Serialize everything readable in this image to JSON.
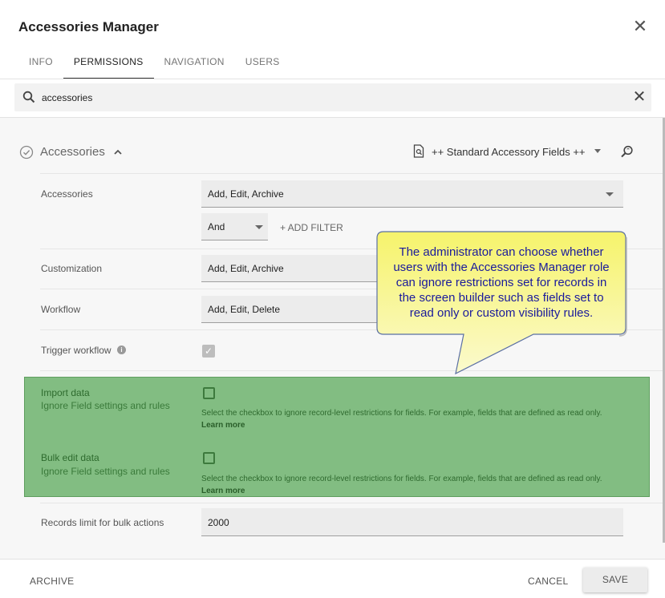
{
  "dialog": {
    "title": "Accessories Manager",
    "close_icon": "close-icon"
  },
  "tabs": [
    {
      "label": "INFO",
      "active": false
    },
    {
      "label": "PERMISSIONS",
      "active": true
    },
    {
      "label": "NAVIGATION",
      "active": false
    },
    {
      "label": "USERS",
      "active": false
    }
  ],
  "search": {
    "value": "accessories",
    "icon": "search-icon",
    "clear_icon": "clear-icon"
  },
  "section": {
    "title": "Accessories",
    "field_set": "++ Standard Accessory Fields ++",
    "icons": [
      "check-circle-icon",
      "chevron-up-icon",
      "document-search-icon",
      "zoom-icon"
    ]
  },
  "rows": {
    "accessories": {
      "label": "Accessories",
      "value": "Add, Edit, Archive"
    },
    "filter": {
      "operator": "And",
      "add_filter": "+ ADD FILTER"
    },
    "customization": {
      "label": "Customization",
      "value": "Add, Edit, Archive"
    },
    "workflow": {
      "label": "Workflow",
      "value": "Add, Edit, Delete"
    },
    "trigger_workflow": {
      "label": "Trigger workflow",
      "checked": true
    },
    "import_data": {
      "label": "Import data",
      "sublabel": "Ignore Field settings and rules",
      "checked": false,
      "help": "Select the checkbox to ignore record-level restrictions for fields. For example, fields that are defined as read only.",
      "learn_more": "Learn more"
    },
    "bulk_edit": {
      "label": "Bulk edit data",
      "sublabel": "Ignore Field settings and rules",
      "checked": false,
      "help": "Select the checkbox to ignore record-level restrictions for fields. For example, fields that are defined as read only.",
      "learn_more": "Learn more"
    },
    "records_limit": {
      "label": "Records limit for bulk actions",
      "value": "2000"
    }
  },
  "callout": {
    "line1": "The administrator can choose whether",
    "line2": "users with the Accessories Manager role",
    "line3": "can ignore restrictions set for records in",
    "line4": "the screen builder such as fields set to",
    "line5": "read only or custom visibility rules."
  },
  "footer": {
    "archive": "ARCHIVE",
    "cancel": "CANCEL",
    "save": "SAVE"
  },
  "colors": {
    "highlight": "#82bd82",
    "callout_fill": "#f4f17a",
    "callout_text": "#1a1a9c"
  }
}
